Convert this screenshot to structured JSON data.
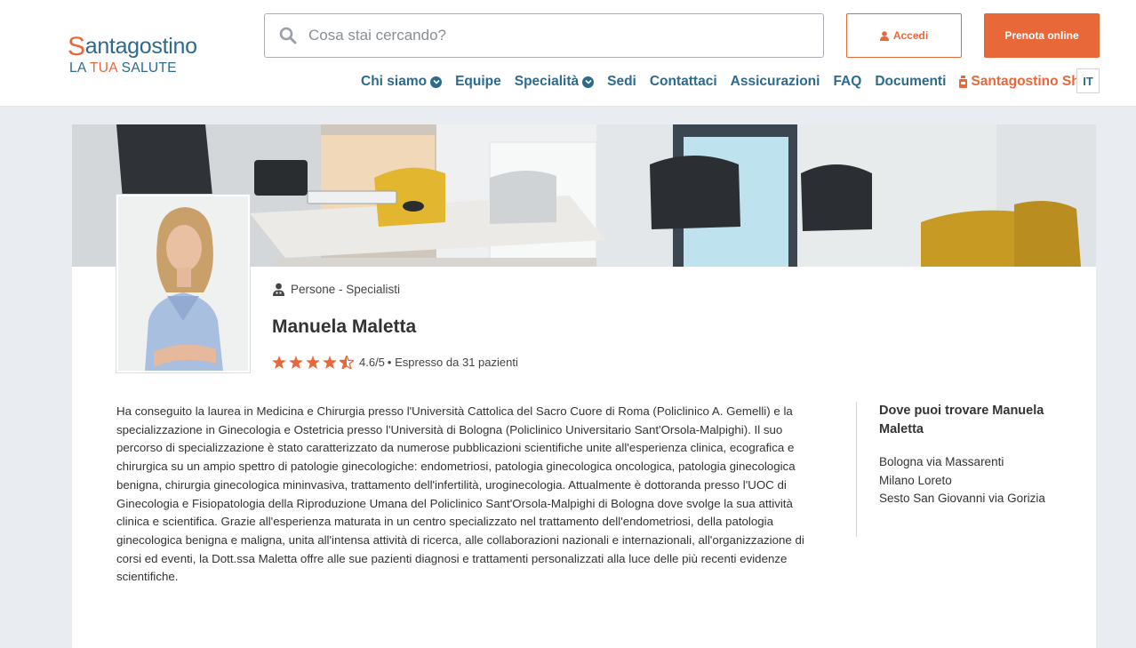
{
  "header": {
    "logo": {
      "brand_initial": "S",
      "brand_rest": "antagostino",
      "tagline_1": "LA ",
      "tagline_2": "TUA",
      "tagline_3": " SALUTE"
    },
    "search": {
      "placeholder": "Cosa stai cercando?",
      "icon": "search-icon"
    },
    "login_label": "Accedi",
    "book_label": "Prenota online",
    "nav": {
      "chi_siamo": "Chi siamo",
      "equipe": "Equipe",
      "specialita": "Specialità",
      "sedi": "Sedi",
      "contattaci": "Contattaci",
      "assicurazioni": "Assicurazioni",
      "faq": "FAQ",
      "documenti": "Documenti",
      "shop": "Santagostino Shop"
    },
    "language": "IT"
  },
  "colors": {
    "brand_blue": "#2c6a8e",
    "brand_orange": "#e8683a"
  },
  "profile": {
    "breadcrumb": "Persone - Specialisti",
    "name": "Manuela Maletta",
    "rating": {
      "score": 4.6,
      "max": 5,
      "text": "4.6/5",
      "reviews_text": "• Espresso da 31 pazienti"
    },
    "bio": "Ha conseguito la laurea in Medicina e Chirurgia presso l'Università Cattolica del Sacro Cuore di Roma (Policlinico A. Gemelli) e la specializzazione in Ginecologia e Ostetricia presso l'Università di Bologna (Policlinico Universitario Sant'Orsola-Malpighi). Il suo percorso di specializzazione è stato caratterizzato da numerose pubblicazioni scientifiche unite all'esperienza clinica, ecografica e chirurgica su un ampio spettro di patologie ginecologiche: endometriosi, patologia ginecologica oncologica, patologia ginecologica benigna, chirurgia ginecologica mininvasiva, trattamento dell'infertilità, uroginecologia. Attualmente è dottoranda presso l'UOC di Ginecologia e Fisiopatologia della Riproduzione Umana del Policlinico Sant'Orsola-Malpighi di Bologna dove svolge la sua attività clinica e scientifica. Grazie all'esperienza maturata in un centro specializzato nel trattamento dell'endometriosi, della patologia ginecologica benigna e maligna, unita all'intensa attività di ricerca, alle collaborazioni nazionali e internazionali, all'organizzazione di corsi ed eventi, la Dott.ssa Maletta offre alle sue pazienti diagnosi e trattamenti personalizzati alla luce delle più recenti evidenze scientifiche.",
    "locations_title": "Dove puoi trovare Manuela Maletta",
    "locations": [
      "Bologna via Massarenti",
      "Milano Loreto",
      "Sesto San Giovanni via Gorizia"
    ]
  }
}
